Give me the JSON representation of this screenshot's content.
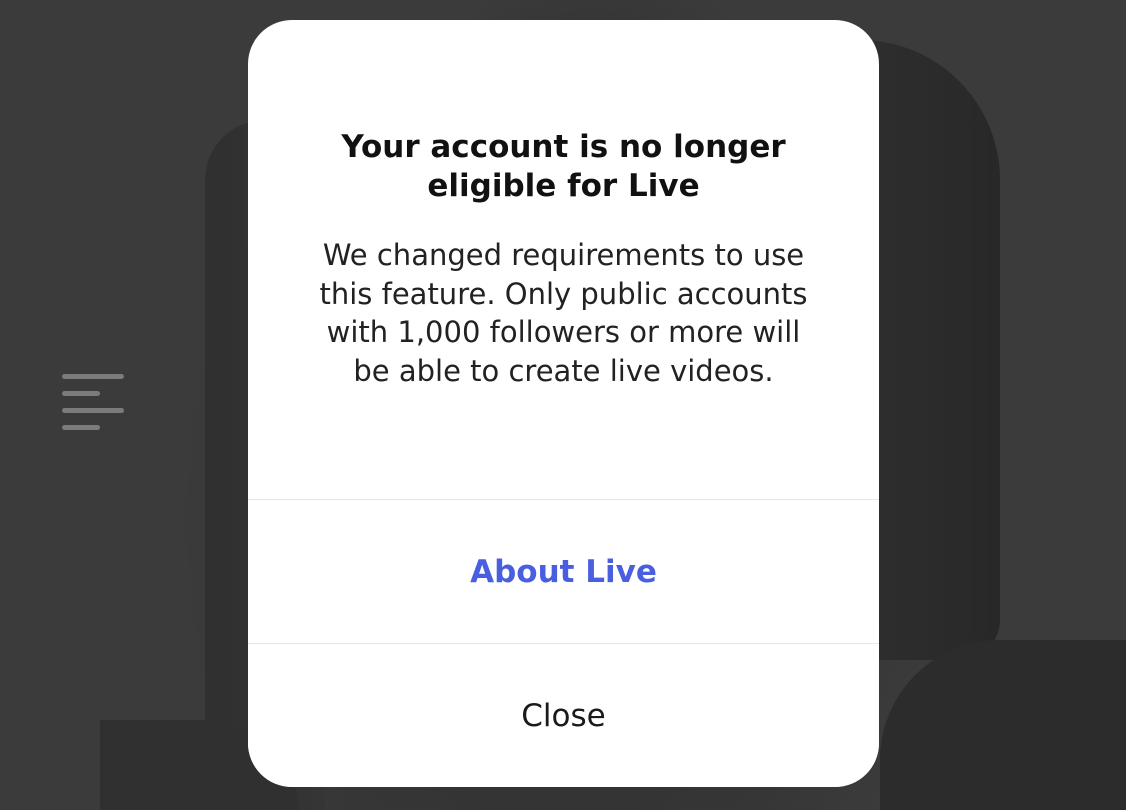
{
  "dialog": {
    "title": "Your account is no longer eligible for Live",
    "body": "We changed requirements to use this feature. Only public accounts with 1,000 followers or more will be able to create live videos.",
    "actions": {
      "primary_label": "About Live",
      "secondary_label": "Close"
    }
  },
  "background": {
    "menu_icon": "menu-lines-icon"
  },
  "colors": {
    "accent": "#4a5ee0",
    "dialog_background": "#ffffff",
    "overlay": "#3a3a3a"
  }
}
